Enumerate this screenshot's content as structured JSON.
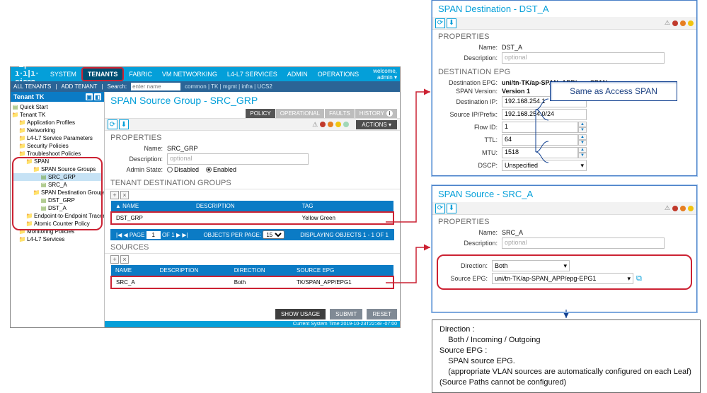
{
  "menu": {
    "system": "SYSTEM",
    "tenants": "TENANTS",
    "fabric": "FABRIC",
    "vm": "VM\nNETWORKING",
    "l4l7": "L4-L7\nSERVICES",
    "admin": "ADMIN",
    "ops": "OPERATIONS",
    "welcome": "welcome,\nadmin ▾"
  },
  "sub": {
    "all": "ALL TENANTS",
    "add": "ADD TENANT",
    "search_label": "Search:",
    "search_ph": "enter name",
    "crumbs": "common | TK | mgmt | infra | UCS2"
  },
  "tree": {
    "title": "Tenant TK",
    "nodes": [
      {
        "ind": 0,
        "ico": "doc",
        "txt": "Quick Start"
      },
      {
        "ind": 0,
        "ico": "folder",
        "txt": "Tenant TK"
      },
      {
        "ind": 1,
        "ico": "folder",
        "txt": "Application Profiles"
      },
      {
        "ind": 1,
        "ico": "folder",
        "txt": "Networking"
      },
      {
        "ind": 1,
        "ico": "folder",
        "txt": "L4-L7 Service Parameters"
      },
      {
        "ind": 1,
        "ico": "folder",
        "txt": "Security Policies"
      },
      {
        "ind": 1,
        "ico": "folder",
        "txt": "Troubleshoot Policies"
      },
      {
        "ind": 2,
        "ico": "folder",
        "txt": "SPAN"
      },
      {
        "ind": 3,
        "ico": "folder",
        "txt": "SPAN Source Groups"
      },
      {
        "ind": 4,
        "ico": "doc",
        "txt": "SRC_GRP",
        "sel": true
      },
      {
        "ind": 4,
        "ico": "doc",
        "txt": "SRC_A"
      },
      {
        "ind": 3,
        "ico": "folder",
        "txt": "SPAN Destination Groups"
      },
      {
        "ind": 4,
        "ico": "doc",
        "txt": "DST_GRP"
      },
      {
        "ind": 4,
        "ico": "doc",
        "txt": "DST_A"
      },
      {
        "ind": 2,
        "ico": "folder",
        "txt": "Endpoint-to-Endpoint Traceroute Pol..."
      },
      {
        "ind": 2,
        "ico": "folder",
        "txt": "Atomic Counter Policy"
      },
      {
        "ind": 1,
        "ico": "folder",
        "txt": "Monitoring Policies"
      },
      {
        "ind": 1,
        "ico": "folder",
        "txt": "L4-L7 Services"
      }
    ]
  },
  "content": {
    "title": "SPAN Source Group - SRC_GRP",
    "tabs": {
      "policy": "POLICY",
      "operational": "OPERATIONAL",
      "faults": "FAULTS",
      "history": "HISTORY"
    },
    "actions": "ACTIONS ▾",
    "props_title": "PROPERTIES",
    "name_lbl": "Name:",
    "name_val": "SRC_GRP",
    "desc_lbl": "Description:",
    "desc_ph": "optional",
    "admin_lbl": "Admin State:",
    "admin_dis": "Disabled",
    "admin_en": "Enabled",
    "tdg_title": "TENANT DESTINATION GROUPS",
    "tdg_cols": {
      "name": "▲ NAME",
      "desc": "DESCRIPTION",
      "tag": "TAG"
    },
    "tdg_row": {
      "name": "DST_GRP",
      "desc": "",
      "tag": "Yellow Green"
    },
    "pager": {
      "page_lbl": "PAGE",
      "page_of": "OF 1",
      "page_val": "1",
      "opp_lbl": "OBJECTS PER PAGE:",
      "opp_val": "15",
      "disp": "DISPLAYING OBJECTS 1 - 1 OF 1"
    },
    "src_title": "SOURCES",
    "src_cols": {
      "name": "NAME",
      "desc": "DESCRIPTION",
      "dir": "DIRECTION",
      "epg": "SOURCE EPG"
    },
    "src_row": {
      "name": "SRC_A",
      "desc": "",
      "dir": "Both",
      "epg": "TK/SPAN_APP/EPG1"
    },
    "show_usage": "SHOW USAGE",
    "submit": "SUBMIT",
    "reset": "RESET",
    "systime": "Current System Time:2019-10-23T22:39 -07:00"
  },
  "panel1": {
    "title": "SPAN Destination - DST_A",
    "props": "PROPERTIES",
    "name_lbl": "Name:",
    "name_val": "DST_A",
    "desc_lbl": "Description:",
    "desc_ph": "optional",
    "epg_title": "DESTINATION EPG",
    "depg_lbl": "Destination EPG:",
    "depg_val": "uni/tn-TK/ap-SPAN_APP/epg-SPAN",
    "ver_lbl": "SPAN Version:",
    "ver_val": "Version 1",
    "dip_lbl": "Destination IP:",
    "dip_val": "192.168.254.1",
    "sip_lbl": "Source IP/Prefix:",
    "sip_val": "192.168.254.0/24",
    "flow_lbl": "Flow ID:",
    "flow_val": "1",
    "ttl_lbl": "TTL:",
    "ttl_val": "64",
    "mtu_lbl": "MTU:",
    "mtu_val": "1518",
    "dscp_lbl": "DSCP:",
    "dscp_val": "Unspecified"
  },
  "panel2": {
    "title": "SPAN Source - SRC_A",
    "props": "PROPERTIES",
    "name_lbl": "Name:",
    "name_val": "SRC_A",
    "desc_lbl": "Description:",
    "desc_ph": "optional",
    "dir_lbl": "Direction:",
    "dir_val": "Both",
    "sepg_lbl": "Source EPG:",
    "sepg_val": "uni/tn-TK/ap-SPAN_APP/epg-EPG1"
  },
  "note1": "Same as Access SPAN",
  "note2": {
    "l1": "Direction :",
    "l2": "    Both / Incoming / Outgoing",
    "l3": "Source EPG :",
    "l4": "    SPAN source EPG.",
    "l5": "    (appropriate VLAN sources are automatically configured on each Leaf)",
    "l6": "(Source Paths cannot be configured)"
  }
}
